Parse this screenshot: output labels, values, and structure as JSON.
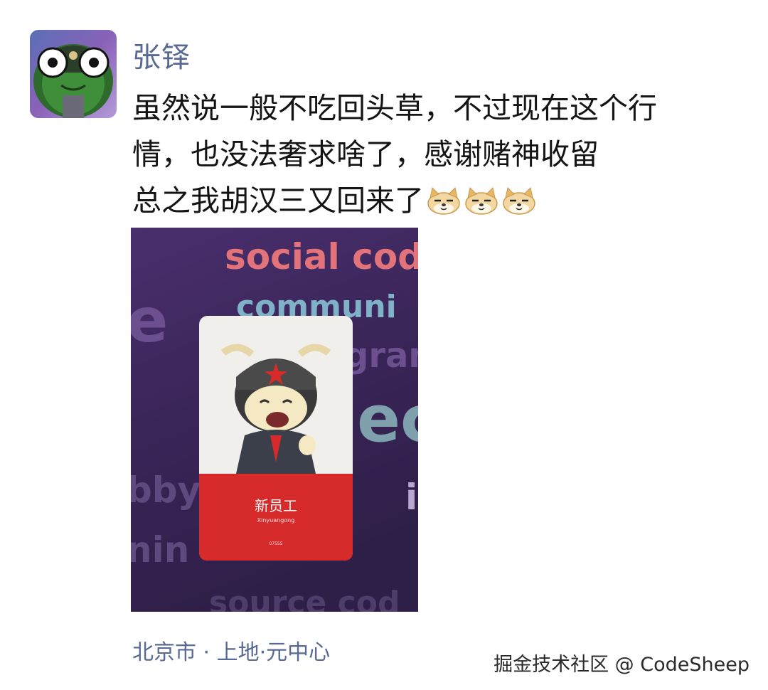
{
  "post": {
    "author": "张铎",
    "text_lines": [
      "虽然说一般不吃回头草，不过现在这个行",
      "情，也没法奢求啥了，感谢赌神收留",
      "总之我胡汉三又回来了"
    ],
    "emoji": [
      "doge-emoji",
      "doge-emoji",
      "doge-emoji"
    ],
    "location": "北京市 · 上地·元中心"
  },
  "photo": {
    "background_words": [
      "social cod",
      "communi",
      "gram",
      "e",
      "ec",
      "bby",
      "i",
      "nin",
      "source cod"
    ],
    "badge": {
      "title": "新员工",
      "pinyin": "Xinyuangong",
      "number": "07555"
    }
  },
  "watermark": "掘金技术社区 @ CodeSheep",
  "colors": {
    "author_link": "#586a94",
    "badge_red": "#d72a2a",
    "photo_bg": "#3e2a5c"
  }
}
